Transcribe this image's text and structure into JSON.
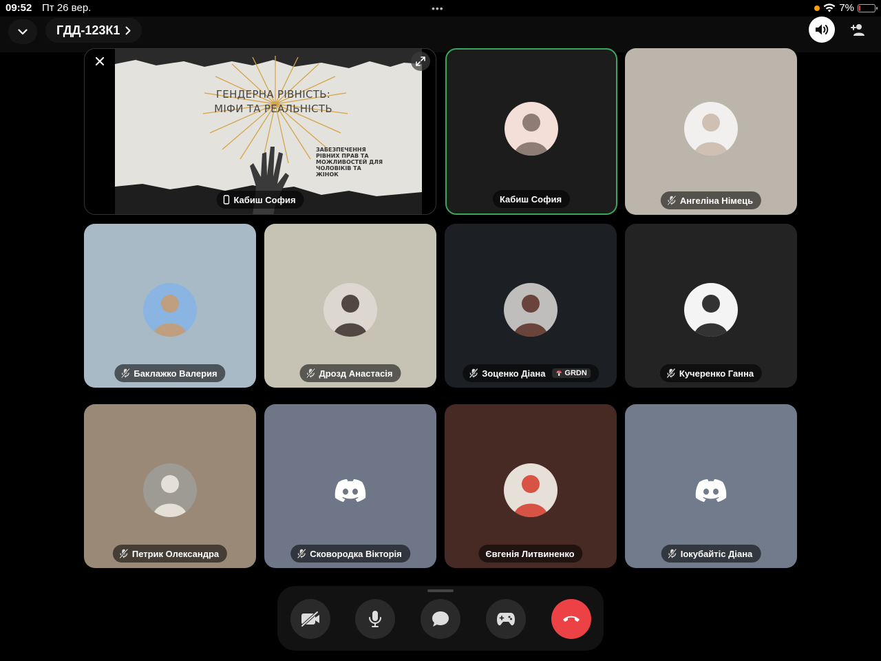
{
  "status_bar": {
    "time": "09:52",
    "date": "Пт 26 вер.",
    "dots": "•••",
    "battery_percent": "7%",
    "battery_level": 0.07
  },
  "header": {
    "channel_name": "ГДД-123К1",
    "collapse_icon": "chevron-down-icon",
    "channel_chevron_icon": "chevron-right-icon",
    "speaker_icon": "speaker-icon",
    "add_user_icon": "add-user-icon"
  },
  "screenshare": {
    "slide_title": "ГЕНДЕРНА РІВНІСТЬ:\nМІФИ ТА РЕАЛЬНІСТЬ",
    "slide_subtitle": "ЗАБЕЗПЕЧЕННЯ РІВНИХ ПРАВ ТА МОЖЛИВОСТЕЙ ДЛЯ ЧОЛОВІКІВ ТА ЖІНОК",
    "label": "Кабиш София",
    "label_icon": "phone-icon",
    "close_icon": "close-icon",
    "expand_icon": "expand-icon"
  },
  "participants": [
    {
      "name": "Кабиш София",
      "bg": "#1b1c1b",
      "muted": false,
      "speaking": true,
      "avatar": "photo"
    },
    {
      "name": "Ангеліна Німець",
      "bg": "#bcb5ab",
      "muted": true,
      "speaking": false,
      "avatar": "photo"
    },
    {
      "name": "Баклажко Валерия",
      "bg": "#a8bac6",
      "muted": true,
      "speaking": false,
      "avatar": "photo"
    },
    {
      "name": "Дрозд Анастасія",
      "bg": "#c6c3b5",
      "muted": true,
      "speaking": false,
      "avatar": "photo"
    },
    {
      "name": "Зоценко Діана",
      "bg": "#1c1f23",
      "muted": true,
      "speaking": false,
      "avatar": "photo",
      "tag": "GRDN"
    },
    {
      "name": "Кучеренко Ганна",
      "bg": "#232323",
      "muted": true,
      "speaking": false,
      "avatar": "photo"
    },
    {
      "name": "Петрик Олександра",
      "bg": "#9b8977",
      "muted": true,
      "speaking": false,
      "avatar": "photo"
    },
    {
      "name": "Сковородка Вікторія",
      "bg": "#6e7687",
      "muted": true,
      "speaking": false,
      "avatar": "discord-logo"
    },
    {
      "name": "Євгенія Литвиненко",
      "bg": "#472a24",
      "muted": false,
      "speaking": false,
      "avatar": "photo"
    },
    {
      "name": "Іокубайтіс Діана",
      "bg": "#717b8c",
      "muted": true,
      "speaking": false,
      "avatar": "discord-logo"
    }
  ],
  "controls": [
    {
      "name": "camera-off",
      "icon": "camera-off-icon",
      "color": "#2a2a2a"
    },
    {
      "name": "microphone",
      "icon": "microphone-icon",
      "color": "#2a2a2a"
    },
    {
      "name": "chat",
      "icon": "chat-icon",
      "color": "#2a2a2a"
    },
    {
      "name": "activities",
      "icon": "gamepad-icon",
      "color": "#2a2a2a"
    },
    {
      "name": "leave-call",
      "icon": "hang-up-icon",
      "color": "#ed4245"
    }
  ]
}
